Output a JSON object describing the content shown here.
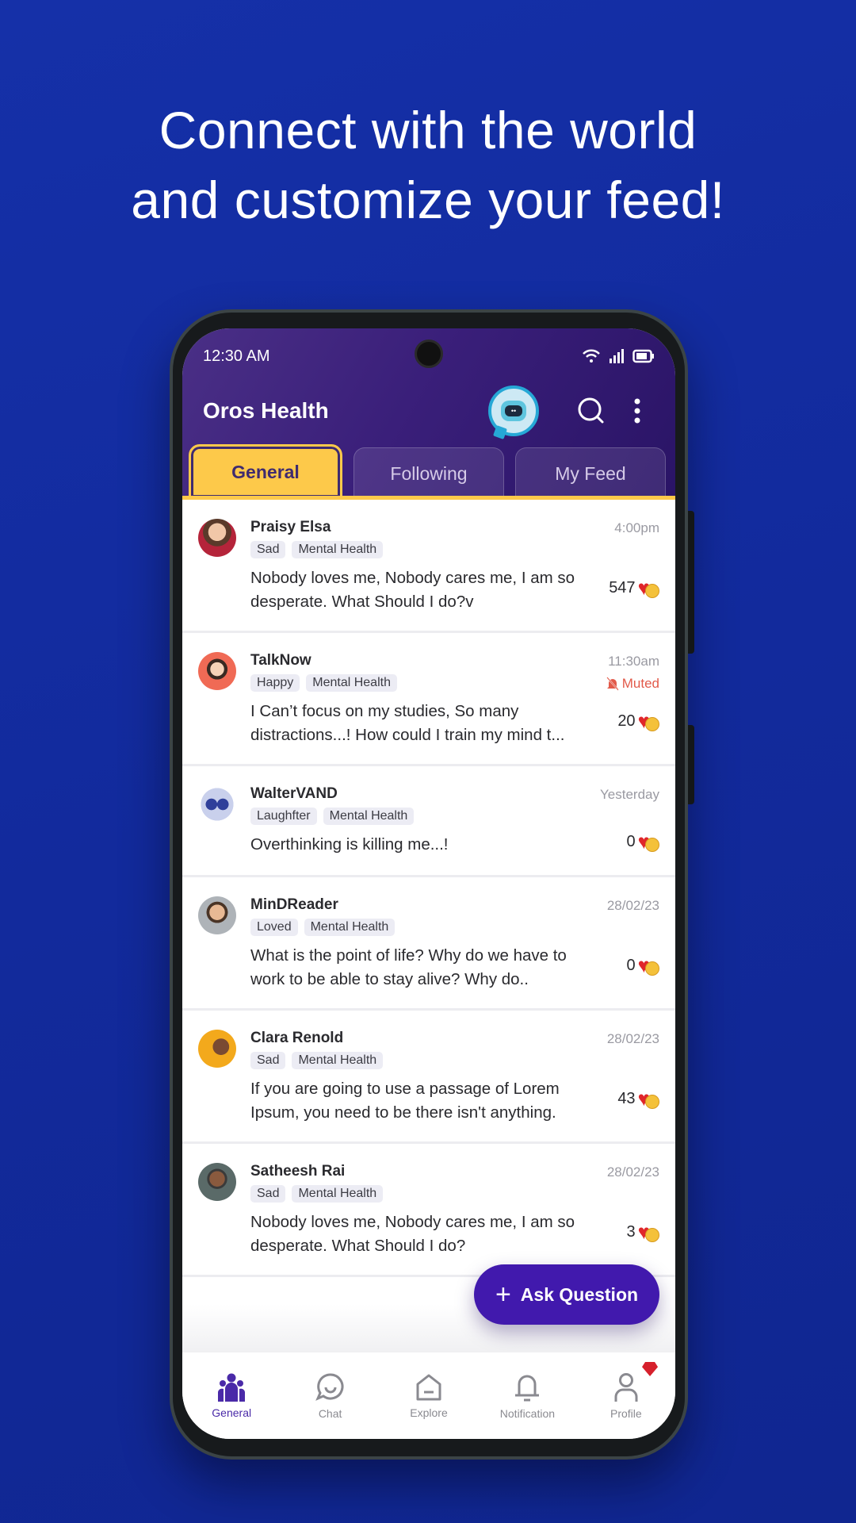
{
  "headline": {
    "line1": "Connect with the world",
    "line2": "and customize your feed!"
  },
  "status_bar": {
    "time": "12:30 AM",
    "icons": [
      "wifi-icon",
      "signal-icon",
      "battery-icon"
    ]
  },
  "app_bar": {
    "title": "Oros Health",
    "bot_icon": "robot-chat-icon",
    "search_icon": "search-icon",
    "menu_icon": "more-vertical-icon"
  },
  "tabs": [
    {
      "label": "General",
      "active": true
    },
    {
      "label": "Following",
      "active": false
    },
    {
      "label": "My Feed",
      "active": false
    }
  ],
  "posts": [
    {
      "name": "Praisy Elsa",
      "time": "4:00pm",
      "tags": [
        "Sad",
        "Mental Health"
      ],
      "body": "Nobody loves me, Nobody cares me, I am so desperate. What Should I do?v",
      "reactions": "547",
      "muted": false,
      "avatar_color": "#b5243a"
    },
    {
      "name": "TalkNow",
      "time": "11:30am",
      "tags": [
        "Happy",
        "Mental Health"
      ],
      "body": "I Can’t focus on my studies, So many distractions...! How could I train my mind t...",
      "reactions": "20",
      "muted": true,
      "muted_label": "Muted",
      "avatar_color": "#f06a55"
    },
    {
      "name": "WalterVAND",
      "time": "Yesterday",
      "tags": [
        "Laughfter",
        "Mental Health"
      ],
      "body": "Overthinking is killing me...!",
      "reactions": "0",
      "muted": false,
      "avatar_color": "#2f3f9a"
    },
    {
      "name": "MinDReader",
      "time": "28/02/23",
      "tags": [
        "Loved",
        "Mental Health"
      ],
      "body": "What is the point of life? Why do we have to work to be able to stay alive? Why do..",
      "reactions": "0",
      "muted": false,
      "avatar_color": "#9aa0a6"
    },
    {
      "name": "Clara Renold",
      "time": "28/02/23",
      "tags": [
        "Sad",
        "Mental Health"
      ],
      "body": "If you are going to use a passage of Lorem Ipsum, you need to be there isn't anything.",
      "reactions": "43",
      "muted": false,
      "avatar_color": "#f3a91c"
    },
    {
      "name": "Satheesh Rai",
      "time": "28/02/23",
      "tags": [
        "Sad",
        "Mental Health"
      ],
      "body": "Nobody loves me, Nobody cares me, I am so desperate. What Should I do?",
      "reactions": "3",
      "muted": false,
      "avatar_color": "#4c5a5a"
    }
  ],
  "fab": {
    "label": "Ask Question",
    "icon": "plus-icon"
  },
  "bottom_nav": [
    {
      "label": "General",
      "icon": "community-icon",
      "active": true
    },
    {
      "label": "Chat",
      "icon": "chat-icon",
      "active": false
    },
    {
      "label": "Explore",
      "icon": "home-icon",
      "active": false
    },
    {
      "label": "Notification",
      "icon": "bell-icon",
      "active": false
    },
    {
      "label": "Profile",
      "icon": "profile-icon",
      "active": false,
      "badge": "gem-icon"
    }
  ],
  "colors": {
    "background": "#1530a8",
    "header": "#3a1f7a",
    "accent_tab": "#fdc94a",
    "fab": "#4119ad",
    "muted": "#e25a4a",
    "heart": "#e0262a"
  }
}
